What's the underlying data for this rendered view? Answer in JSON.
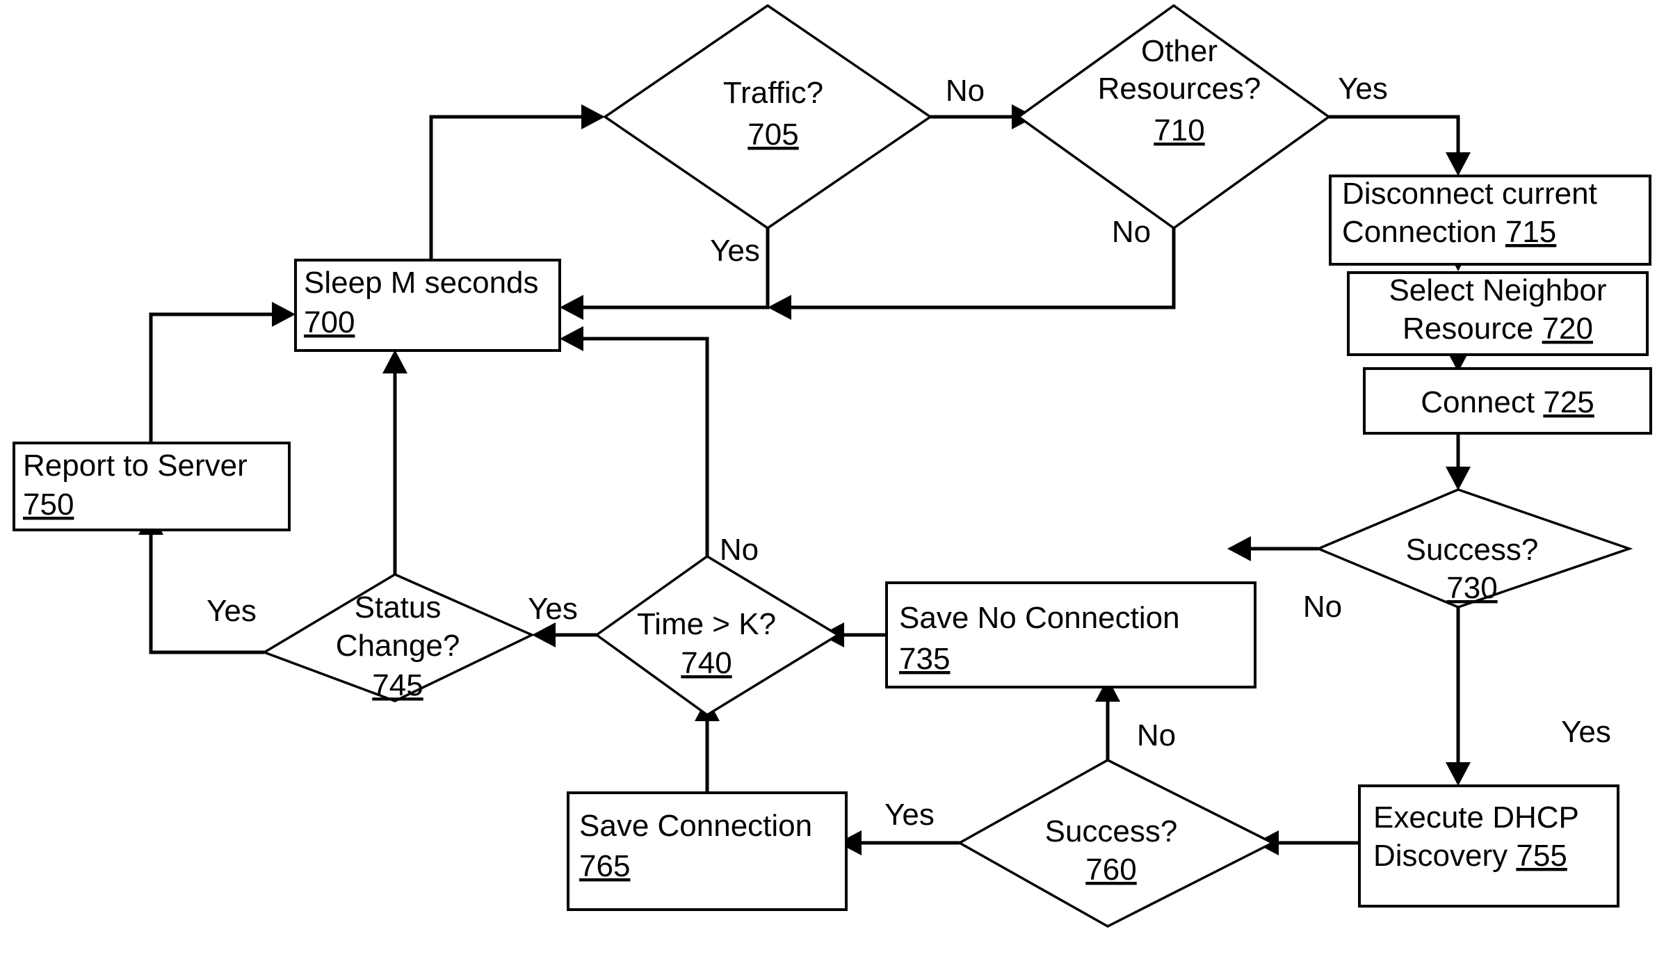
{
  "diagram": {
    "type": "flowchart",
    "title": "Wireless connection monitoring and DHCP discovery flowchart",
    "nodes": [
      {
        "id": "700",
        "shape": "process",
        "label": "Sleep M seconds",
        "ref": "700"
      },
      {
        "id": "705",
        "shape": "decision",
        "label": "Traffic?",
        "ref": "705"
      },
      {
        "id": "710",
        "shape": "decision",
        "label_line1": "Other",
        "label_line2": "Resources?",
        "ref": "710"
      },
      {
        "id": "715",
        "shape": "process",
        "label_line1": "Disconnect current",
        "label_line2": "Connection",
        "ref": "715"
      },
      {
        "id": "720",
        "shape": "process",
        "label_line1": "Select Neighbor",
        "label_line2": "Resource",
        "ref": "720"
      },
      {
        "id": "725",
        "shape": "process",
        "label": "Connect",
        "ref": "725"
      },
      {
        "id": "730",
        "shape": "decision",
        "label": "Success?",
        "ref": "730"
      },
      {
        "id": "735",
        "shape": "process",
        "label": "Save No Connection",
        "ref": "735"
      },
      {
        "id": "740",
        "shape": "decision",
        "label": "Time > K?",
        "ref": "740"
      },
      {
        "id": "745",
        "shape": "decision",
        "label_line1": "Status",
        "label_line2": "Change?",
        "ref": "745"
      },
      {
        "id": "750",
        "shape": "process",
        "label": "Report to Server",
        "ref": "750"
      },
      {
        "id": "755",
        "shape": "process",
        "label_line1": "Execute DHCP",
        "label_line2": "Discovery",
        "ref": "755"
      },
      {
        "id": "760",
        "shape": "decision",
        "label": "Success?",
        "ref": "760"
      },
      {
        "id": "765",
        "shape": "process",
        "label": "Save Connection",
        "ref": "765"
      }
    ],
    "edge_labels": {
      "traffic_no": "No",
      "traffic_yes": "Yes",
      "other_resources_yes": "Yes",
      "other_resources_no": "No",
      "success730_no": "No",
      "success730_yes": "Yes",
      "time_k_no": "No",
      "time_k_yes": "Yes",
      "status_change_yes": "Yes",
      "success760_no": "No",
      "success760_yes": "Yes"
    },
    "colors": {
      "stroke": "#000000",
      "fill": "#ffffff",
      "text": "#000000"
    }
  }
}
